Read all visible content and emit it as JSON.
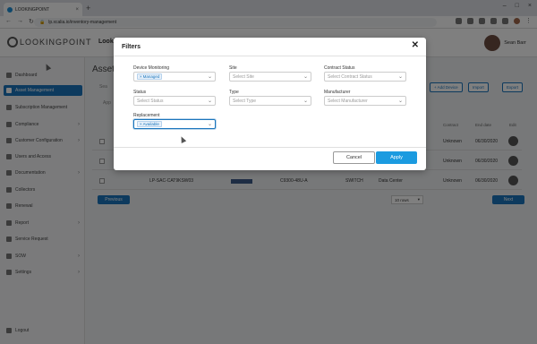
{
  "browser": {
    "tab_title": "LOOKINGPOINT",
    "tab_close": "×",
    "new_tab": "+",
    "url": "lp.xcalia.io/inventory-management",
    "back": "←",
    "forward": "→",
    "reload": "↻",
    "window_controls": [
      "–",
      "□",
      "×"
    ]
  },
  "app": {
    "logo_text": "LOOKINGPOINT",
    "header_peek": "Looki",
    "user_name": "Sean Barr"
  },
  "sidebar": {
    "items": [
      {
        "label": "Dashboard",
        "chevron": ""
      },
      {
        "label": "Asset Management",
        "chevron": ""
      },
      {
        "label": "Subscription Management",
        "chevron": ""
      },
      {
        "label": "Compliance",
        "chevron": "›"
      },
      {
        "label": "Customer Configuration",
        "chevron": "›"
      },
      {
        "label": "Users and Access",
        "chevron": ""
      },
      {
        "label": "Documentation",
        "chevron": "›"
      },
      {
        "label": "Collectors",
        "chevron": ""
      },
      {
        "label": "Renewal",
        "chevron": ""
      },
      {
        "label": "Report",
        "chevron": "›"
      },
      {
        "label": "Service Request",
        "chevron": ""
      },
      {
        "label": "SOW",
        "chevron": "›"
      },
      {
        "label": "Settings",
        "chevron": "›"
      }
    ],
    "logout": "Logout"
  },
  "main": {
    "title_peek": "Asset",
    "search_peek": "Sea",
    "apply_peek": "App",
    "actions": {
      "add_device": "+ Add Device",
      "import": "Import",
      "export": "Export"
    },
    "columns": {
      "contract": "Contract",
      "end_date": "End date",
      "edit": "Edit"
    },
    "rows": [
      {
        "device": "",
        "model": "",
        "type": "",
        "location": "",
        "contract": "Unknown",
        "end_date": "06/30/2020"
      },
      {
        "device": "",
        "model": "",
        "type": "",
        "location": "",
        "contract": "Unknown",
        "end_date": "06/30/2020"
      },
      {
        "device": "LP-SAC-CAT9KSW03",
        "model": "C9300-48U-A",
        "type": "SWITCH",
        "location": "Data Center",
        "contract": "Unknown",
        "end_date": "06/30/2020"
      }
    ],
    "previous": "Previous",
    "next": "Next",
    "rows_select": "10 rows"
  },
  "filters_modal": {
    "title": "Filters",
    "fields": {
      "device_monitoring": {
        "label": "Device Monitoring",
        "chip": "Managed"
      },
      "site": {
        "label": "Site",
        "placeholder": "Select Site"
      },
      "contract_status": {
        "label": "Contract Status",
        "placeholder": "Select Contract Status"
      },
      "status": {
        "label": "Status",
        "placeholder": "Select Status"
      },
      "type": {
        "label": "Type",
        "placeholder": "Select Type"
      },
      "manufacturer": {
        "label": "Manufacturer",
        "placeholder": "Select Manufacturer"
      },
      "replacement": {
        "label": "Replacement",
        "chip": "Available"
      }
    },
    "cancel_label": "Cancel",
    "apply_label": "Apply"
  },
  "colors": {
    "accent": "#1b75bc",
    "apply_button": "#1b9be0",
    "overlay": "rgba(0,0,0,0.5)"
  }
}
